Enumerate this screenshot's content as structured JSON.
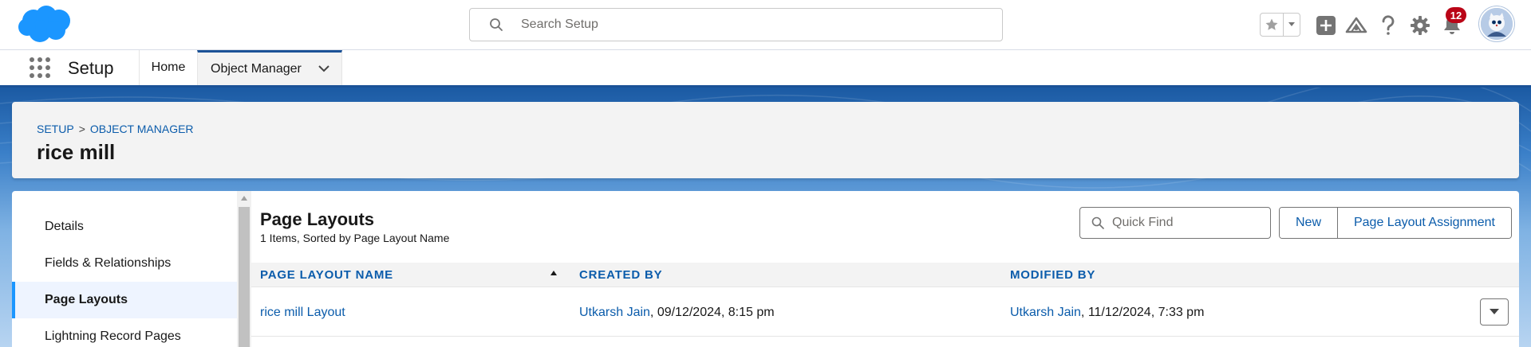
{
  "header": {
    "search_placeholder": "Search Setup",
    "notification_count": "12",
    "brand_color": "#1b96ff"
  },
  "context_nav": {
    "app_name": "Setup",
    "tabs": [
      {
        "label": "Home"
      },
      {
        "label": "Object Manager"
      }
    ]
  },
  "page_header": {
    "breadcrumb": [
      "SETUP",
      ">",
      "OBJECT MANAGER"
    ],
    "title": "rice mill"
  },
  "sidebar": {
    "items": [
      {
        "label": "Details"
      },
      {
        "label": "Fields & Relationships"
      },
      {
        "label": "Page Layouts",
        "active": true
      },
      {
        "label": "Lightning Record Pages"
      }
    ]
  },
  "main": {
    "title": "Page Layouts",
    "subtitle": "1 Items, Sorted by Page Layout Name",
    "quickfind_placeholder": "Quick Find",
    "new_label": "New",
    "assignment_label": "Page Layout Assignment",
    "columns": [
      "PAGE LAYOUT NAME",
      "CREATED BY",
      "MODIFIED BY"
    ],
    "rows": [
      {
        "name": "rice mill Layout",
        "created_by_user": "Utkarsh Jain",
        "created_by_date": ", 09/12/2024, 8:15 pm",
        "modified_by_user": "Utkarsh Jain",
        "modified_by_date": ", 11/12/2024, 7:33 pm"
      }
    ]
  }
}
